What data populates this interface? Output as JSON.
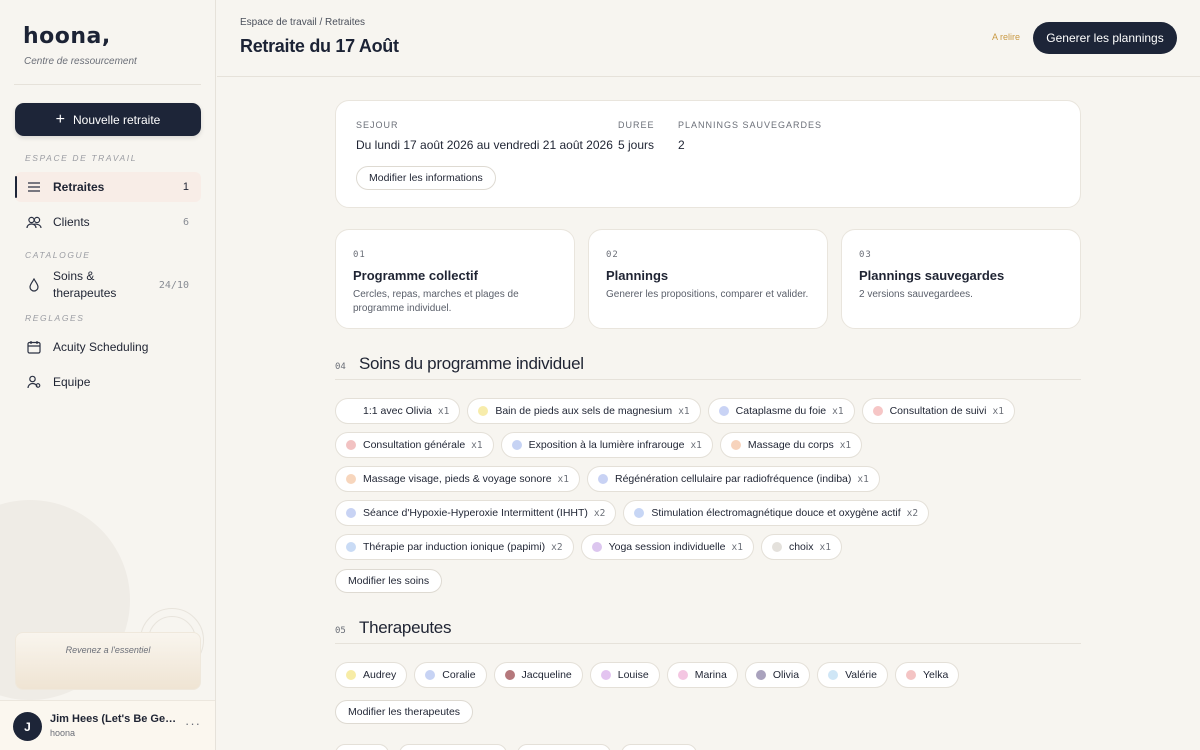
{
  "sidebar": {
    "logo": "hoona,",
    "tagline": "Centre de ressourcement",
    "new_retreat": "Nouvelle retraite",
    "sections": {
      "workspace": "ESPACE DE TRAVAIL",
      "catalog": "CATALOGUE",
      "settings": "REGLAGES"
    },
    "items": [
      {
        "label": "Retraites",
        "count": "1",
        "icon": "list-icon"
      },
      {
        "label": "Clients",
        "count": "6",
        "icon": "users-icon"
      },
      {
        "label": "Soins & therapeutes",
        "count": "24/10",
        "icon": "drop-icon"
      },
      {
        "label": "Acuity Scheduling",
        "icon": "calendar-icon"
      },
      {
        "label": "Equipe",
        "icon": "team-icon"
      }
    ],
    "promo": "Revenez a l'essentiel",
    "user": {
      "initial": "J",
      "name": "Jim Hees (Let's Be Geeks)",
      "org": "hoona",
      "more": "···"
    }
  },
  "header": {
    "breadcrumb": "Espace de travail / Retraites",
    "title": "Retraite du 17 Août",
    "review": "A relire",
    "generate": "Generer les plannings"
  },
  "stay": {
    "stay_label": "SEJOUR",
    "stay_value": "Du lundi 17 août 2026 au vendredi 21 août 2026",
    "duration_label": "DUREE",
    "duration_value": "5 jours",
    "saved_label": "PLANNINGS SAUVEGARDES",
    "saved_value": "2",
    "edit": "Modifier les informations"
  },
  "steps": [
    {
      "num": "01",
      "title": "Programme collectif",
      "desc": "Cercles, repas, marches et plages de programme individuel."
    },
    {
      "num": "02",
      "title": "Plannings",
      "desc": "Generer les propositions, comparer et valider."
    },
    {
      "num": "03",
      "title": "Plannings sauvegardes",
      "desc": "2 versions sauvegardees."
    }
  ],
  "treatments": {
    "num": "04",
    "title": "Soins du programme individuel",
    "edit": "Modifier les soins",
    "items": [
      {
        "name": "1:1 avec Olivia",
        "qty": "x1",
        "color": "#ffffff"
      },
      {
        "name": "Bain de pieds aux sels de magnesium",
        "qty": "x1",
        "color": "#f7ecab"
      },
      {
        "name": "Cataplasme du foie",
        "qty": "x1",
        "color": "#c9d3f5"
      },
      {
        "name": "Consultation de suivi",
        "qty": "x1",
        "color": "#f6c6c6"
      },
      {
        "name": "Consultation générale",
        "qty": "x1",
        "color": "#f2c2c2"
      },
      {
        "name": "Exposition à la lumière infrarouge",
        "qty": "x1",
        "color": "#c6d3f4"
      },
      {
        "name": "Massage du corps",
        "qty": "x1",
        "color": "#f7d3bc"
      },
      {
        "name": "Massage visage, pieds & voyage sonore",
        "qty": "x1",
        "color": "#f7d6bd"
      },
      {
        "name": "Régénération cellulaire par radiofréquence (indiba)",
        "qty": "x1",
        "color": "#c8d2f4"
      },
      {
        "name": "Séance d'Hypoxie-Hyperoxie Intermittent (IHHT)",
        "qty": "x2",
        "color": "#c8d3f4"
      },
      {
        "name": "Stimulation électromagnétique douce et oxygène actif",
        "qty": "x2",
        "color": "#c7d6f5"
      },
      {
        "name": "Thérapie par induction ionique (papimi)",
        "qty": "x2",
        "color": "#c9dbf5"
      },
      {
        "name": "Yoga session individuelle",
        "qty": "x1",
        "color": "#dcc6ef"
      },
      {
        "name": "choix",
        "qty": "x1",
        "color": "#e4e1dc"
      }
    ]
  },
  "therapists": {
    "num": "05",
    "title": "Therapeutes",
    "edit": "Modifier les therapeutes",
    "items": [
      {
        "name": "Audrey",
        "color": "#f7eca6"
      },
      {
        "name": "Coralie",
        "color": "#c7d3f4"
      },
      {
        "name": "Jacqueline",
        "color": "#b5787c"
      },
      {
        "name": "Louise",
        "color": "#e3c4f0"
      },
      {
        "name": "Marina",
        "color": "#f4c6e2"
      },
      {
        "name": "Olivia",
        "color": "#a9a2bd"
      },
      {
        "name": "Valérie",
        "color": "#cfe6f6"
      },
      {
        "name": "Yelka",
        "color": "#f4c4c4"
      }
    ]
  }
}
